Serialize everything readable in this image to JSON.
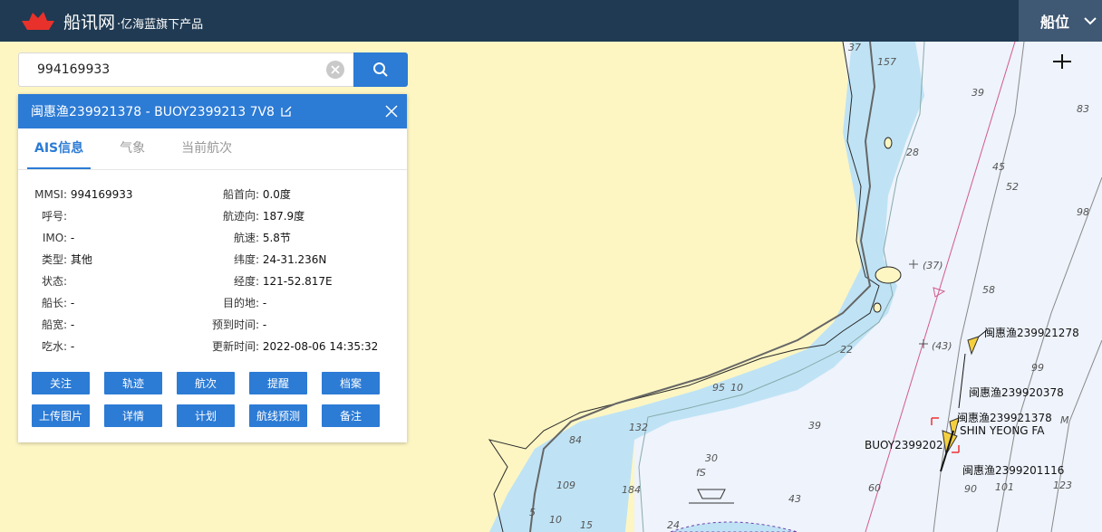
{
  "header": {
    "title": "船讯网",
    "subtitle": "·亿海蓝旗下产品",
    "menu_label": "船位"
  },
  "search": {
    "value": "994169933"
  },
  "panel": {
    "title": "闽惠渔239921378 -   BUOY2399213 7V8",
    "tabs": [
      "AIS信息",
      "气象",
      "当前航次"
    ],
    "left": [
      {
        "k": "MMSI:",
        "v": "994169933"
      },
      {
        "k": "呼号:",
        "v": ""
      },
      {
        "k": "IMO:",
        "v": "-"
      },
      {
        "k": "类型:",
        "v": "其他"
      },
      {
        "k": "状态:",
        "v": ""
      },
      {
        "k": "船长:",
        "v": "-"
      },
      {
        "k": "船宽:",
        "v": "-"
      },
      {
        "k": "吃水:",
        "v": "-"
      }
    ],
    "right": [
      {
        "k": "船首向:",
        "v": "0.0度"
      },
      {
        "k": "航迹向:",
        "v": "187.9度"
      },
      {
        "k": "航速:",
        "v": "5.8节"
      },
      {
        "k": "纬度:",
        "v": "24-31.236N"
      },
      {
        "k": "经度:",
        "v": "121-52.817E"
      },
      {
        "k": "目的地:",
        "v": "-"
      },
      {
        "k": "预到时间:",
        "v": "-"
      },
      {
        "k": "更新时间:",
        "v": "2022-08-06 14:35:32"
      }
    ],
    "buttons_row1": [
      "关注",
      "轨迹",
      "航次",
      "提醒",
      "档案"
    ],
    "buttons_row2": [
      "上传图片",
      "详情",
      "计划",
      "航线预测",
      "备注"
    ]
  },
  "map": {
    "vessel_labels": [
      "闽惠渔239921278",
      "闽惠渔239920378",
      "闽惠渔239921378",
      "SHIN YEONG FA",
      "BUOY2399202",
      "闽惠渔2399201116"
    ],
    "depths": [
      "37",
      "157",
      "39",
      "83",
      "28",
      "45",
      "52",
      "98",
      "(37)",
      "58",
      "22",
      "(43)",
      "99",
      "M",
      "95",
      "10",
      "132",
      "39",
      "84",
      "30",
      "fS",
      "109",
      "184",
      "43",
      "60",
      "90",
      "101",
      "123",
      "10",
      "15",
      "24",
      "5"
    ]
  },
  "colors": {
    "accent": "#2c7bd5",
    "topbar": "#1f3a52",
    "land": "#fdf6c3",
    "shallow": "#bfe3f5",
    "deep": "#eef3fc"
  }
}
